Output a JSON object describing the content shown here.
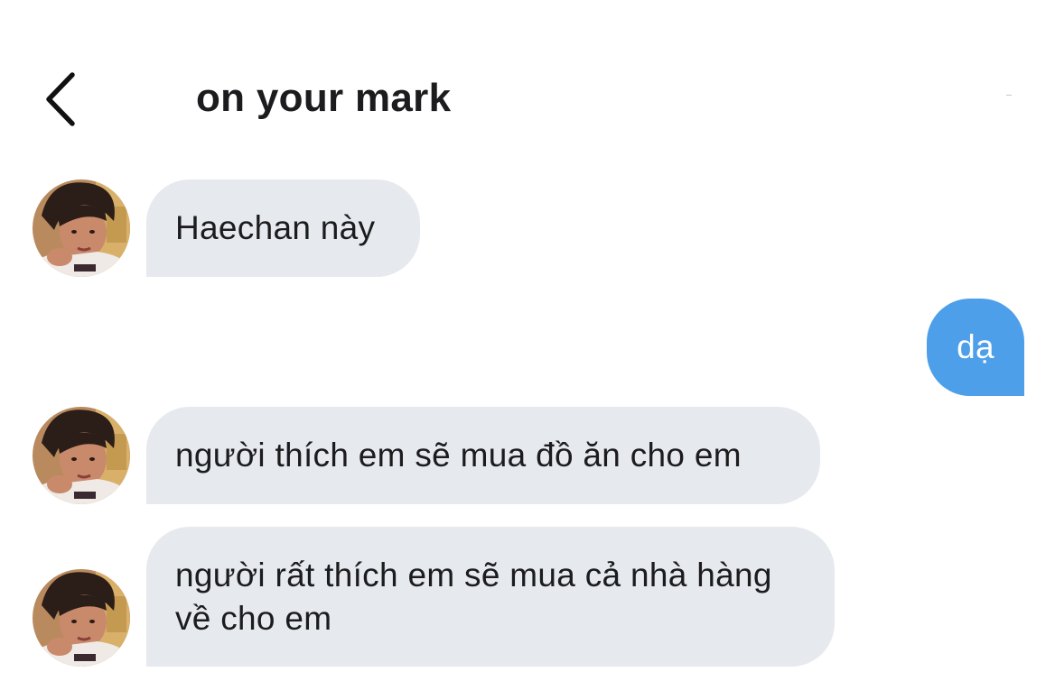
{
  "header": {
    "back_icon": "chevron-left-icon",
    "title": "on your mark"
  },
  "colors": {
    "incoming_bubble": "#e6e9ed",
    "outgoing_bubble": "#4d9fe9",
    "text": "#1c1c1e"
  },
  "messages": [
    {
      "sender": "them",
      "text": "Haechan này"
    },
    {
      "sender": "me",
      "text": "dạ"
    },
    {
      "sender": "them",
      "text": "người thích em sẽ mua đồ ăn cho em"
    },
    {
      "sender": "them",
      "text": "người rất thích em sẽ mua cả nhà hàng về cho em"
    }
  ]
}
